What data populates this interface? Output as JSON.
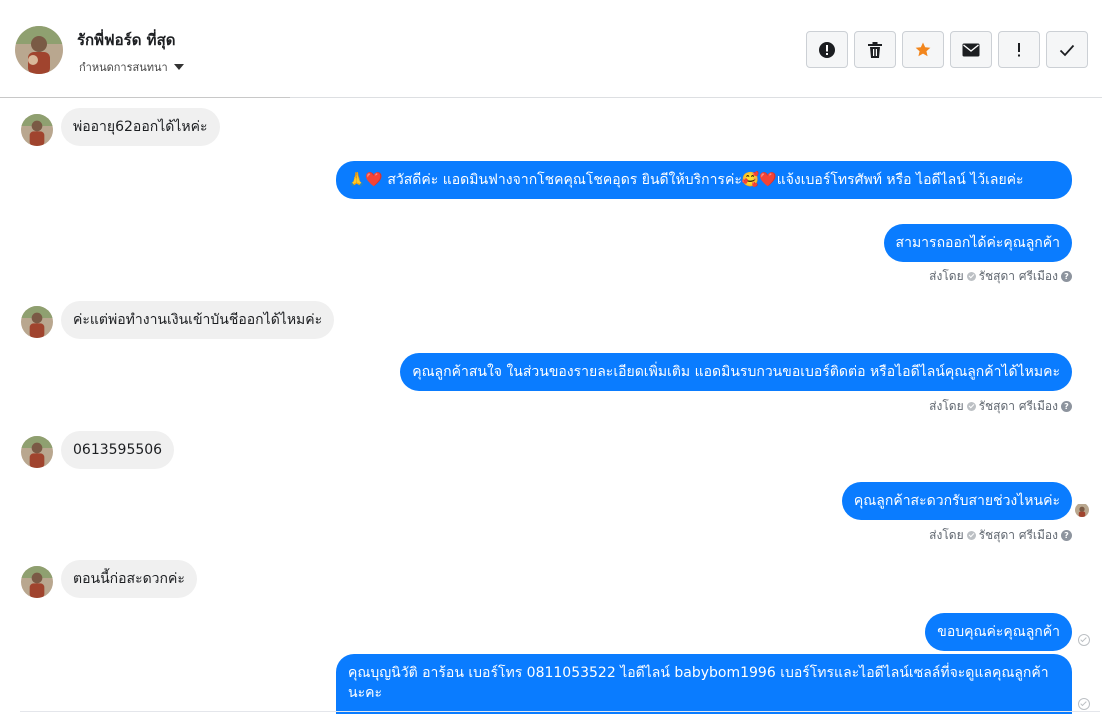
{
  "header": {
    "contact_name": "รักพี่ฟอร์ด ที่สุด",
    "conversation_menu": "กำหนดการสนทนา",
    "toolbar": [
      {
        "name": "spam-button",
        "icon": "alert-circle-icon",
        "color": "#1c1e21"
      },
      {
        "name": "delete-button",
        "icon": "trash-icon",
        "color": "#1c1e21"
      },
      {
        "name": "star-button",
        "icon": "star-icon",
        "color": "#f2861d"
      },
      {
        "name": "mark-unread-button",
        "icon": "envelope-icon",
        "color": "#1c1e21"
      },
      {
        "name": "follow-up-button",
        "icon": "exclamation-icon",
        "color": "#1c1e21"
      },
      {
        "name": "mark-done-button",
        "icon": "check-icon",
        "color": "#1c1e21"
      }
    ]
  },
  "messages": {
    "m1": "พ่ออายุ62ออกได้ไหค่ะ",
    "m2": "🙏❤️ สวัสดีค่ะ แอดมินฟางจากโชคคุณโชคอุดร ยินดีให้บริการค่ะ🥰❤️แจ้งเบอร์โทรศัพท์ หรือ ไอดีไลน์  ไว้เลยค่ะ",
    "m3": "สามารถออกได้ค่ะคุณลูกค้า",
    "m4": "ค่ะแต่พ่อทำงานเงินเข้าบันชีออกได้ไหมค่ะ",
    "m5": "คุณลูกค้าสนใจ ในส่วนของรายละเอียดเพิ่มเติม แอดมินรบกวนขอเบอร์ติดต่อ หรือไอดีไลน์คุณลูกค้าได้ไหมคะ",
    "m6": "0613595506",
    "m7": "คุณลูกค้าสะดวกรับสายช่วงไหนค่ะ",
    "m8": "ตอนนี้ก่อสะดวกค่ะ",
    "m9": "ขอบคุณค่ะคุณลูกค้า",
    "m10": "คุณบุญนิวัติ  อาร้อน        เบอร์โทร 0811053522  ไอดีไลน์ babybom1996   เบอร์โทรและไอดีไลน์เซลล์ที่จะดูแลคุณลูกค้านะคะ"
  },
  "sent_by": {
    "prefix": "ส่งโดย",
    "agent": "รัชสุดา ศรีเมือง"
  },
  "colors": {
    "outgoing_bubble": "#0a7cff",
    "incoming_bubble": "#f0f0f0",
    "star": "#f2861d"
  }
}
